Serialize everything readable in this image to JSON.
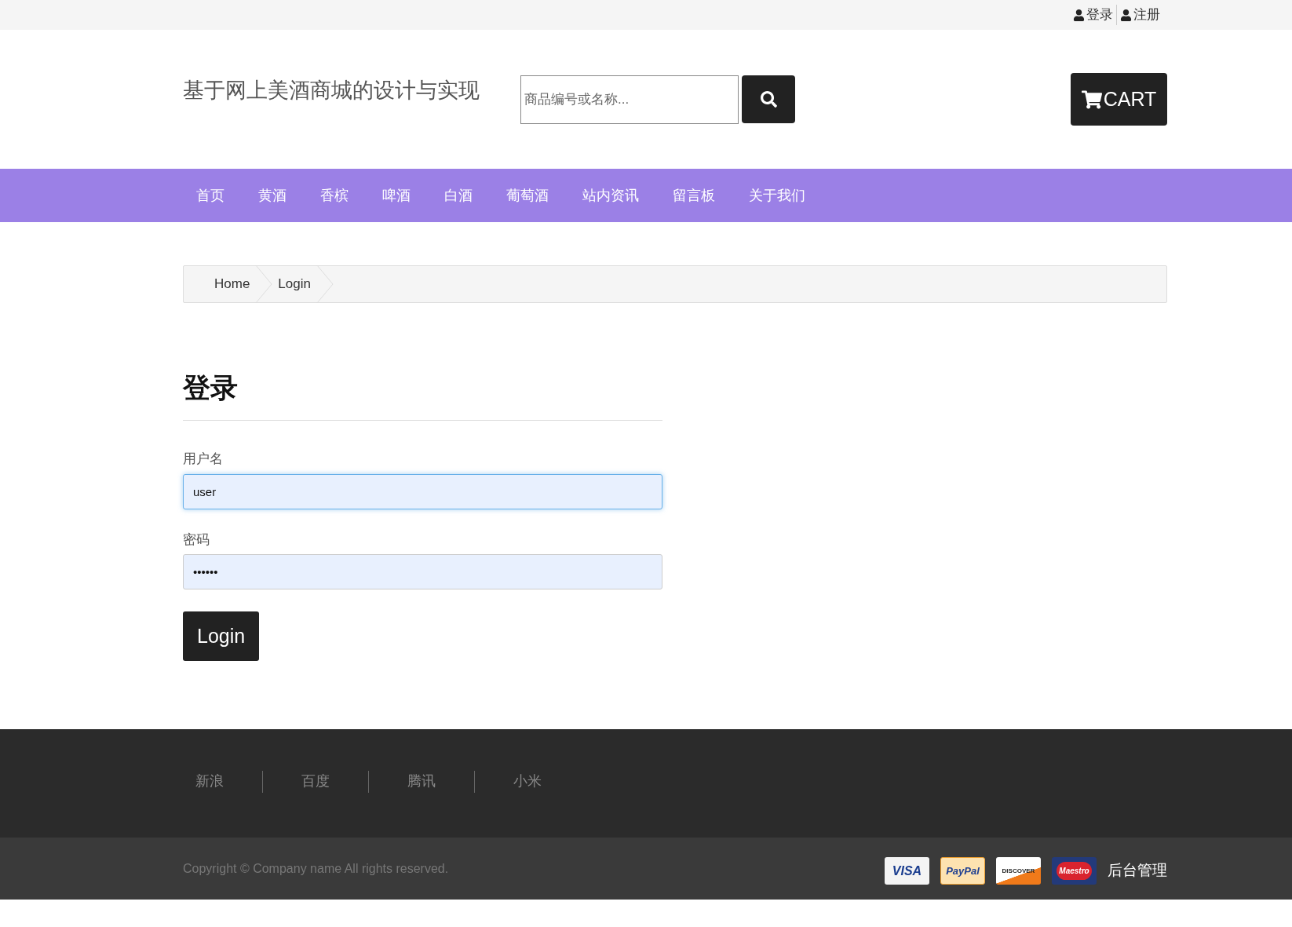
{
  "top_bar": {
    "links": [
      {
        "label": "登录"
      },
      {
        "label": "注册"
      }
    ]
  },
  "header": {
    "site_title": "基于网上美酒商城的设计与实现",
    "search": {
      "placeholder": "商品编号或名称..."
    },
    "cart_label": "CART"
  },
  "nav": {
    "items": [
      {
        "label": "首页"
      },
      {
        "label": "黄酒"
      },
      {
        "label": "香槟"
      },
      {
        "label": "啤酒"
      },
      {
        "label": "白酒"
      },
      {
        "label": "葡萄酒"
      },
      {
        "label": "站内资讯"
      },
      {
        "label": "留言板"
      },
      {
        "label": "关于我们"
      }
    ]
  },
  "breadcrumb": [
    {
      "label": "Home"
    },
    {
      "label": "Login"
    }
  ],
  "login_form": {
    "title": "登录",
    "fields": [
      {
        "label": "用户名",
        "value": "user",
        "focused": true
      },
      {
        "label": "密码",
        "value": "••••••",
        "focused": false
      }
    ],
    "submit": "Login"
  },
  "footer": {
    "links": [
      {
        "label": "新浪"
      },
      {
        "label": "百度"
      },
      {
        "label": "腾讯"
      },
      {
        "label": "小米"
      }
    ],
    "copyright": "Copyright © Company name All rights reserved.",
    "payment_logos": [
      {
        "kind": "visa",
        "label": "VISA"
      },
      {
        "kind": "paypal",
        "label": "PayPal"
      },
      {
        "kind": "discover",
        "label": "DISCOVER"
      },
      {
        "kind": "maestro",
        "label": "Maestro"
      }
    ],
    "admin_link": "后台管理"
  }
}
